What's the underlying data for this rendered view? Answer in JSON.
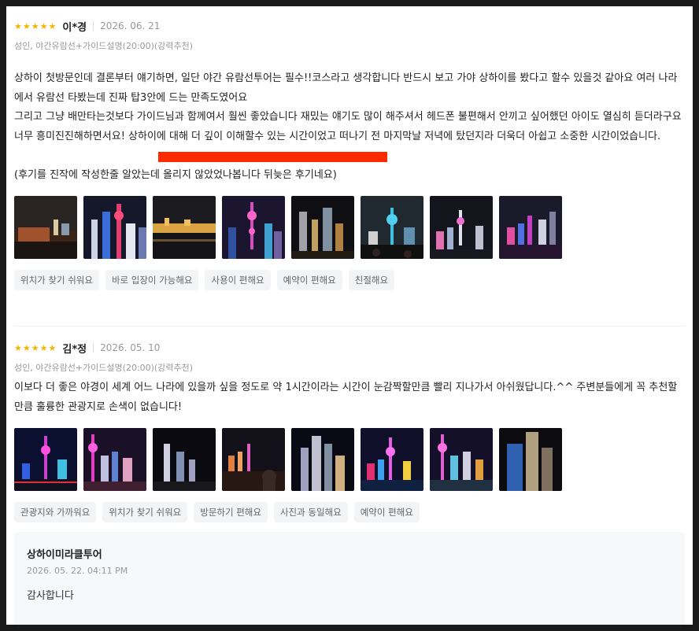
{
  "reviews": [
    {
      "rating_stars": "★★★★★",
      "author": "이*경",
      "date": "2026. 06. 21",
      "option": "성인, 야간유람선+가이드설명(20:00)(강력추천)",
      "body": "상하이 첫방문인데 결론부터 얘기하면, 일단 야간 유람선투어는 필수!!코스라고 생각합니다 반드시 보고 가야 상하이를 봤다고 할수 있을것 같아요 여러 나라에서 유람선 타봤는데 진짜 탑3안에 드는 만족도였어요\n그리고 그냥 배만타는것보다 가이드님과 함께여서 훨씬 좋았습니다 재밌는 얘기도 많이 해주셔서 헤드폰 불편해서 안끼고 싶어했던 아이도 열심히 듣더라구요 너무 흥미진진해하면서요! 상하이에 대해 더 깊이 이해할수 있는 시간이었고 떠나기 전 마지막날 저녁에 탔던지라 더욱더 아쉽고 소중한 시간이었습니다.\n\n(후기를 진작에 작성한줄 알았는데 올리지 않았었나봅니다 뒤늦은 후기네요)",
      "tags": [
        "위치가 찾기 쉬워요",
        "바로 입장이 가능해요",
        "사용이 편해요",
        "예약이 편해요",
        "친절해요"
      ]
    },
    {
      "rating_stars": "★★★★★",
      "author": "김*정",
      "date": "2026. 05. 10",
      "option": "성인, 야간유람선+가이드설명(20:00)(강력추천)",
      "body": "이보다 더 좋은 야경이 세계 어느 나라에 있을까 싶을 정도로 약 1시간이라는 시간이 눈감짝할만큼 빨리 지나가서 아쉬웠답니다.^^ 주변분들에게 꼭 추천할만큼 훌륭한 관광지로 손색이 없습니다!",
      "tags": [
        "관광지와 가까워요",
        "위치가 찾기 쉬워요",
        "방문하기 편해요",
        "사진과 동일해요",
        "예약이 편해요"
      ]
    }
  ],
  "reply": {
    "name": "상하이미라클투어",
    "date": "2026. 05. 22. 04:11 PM",
    "text": "감사합니다"
  },
  "colors": {
    "star": "#f5b400",
    "highlight": "#ff2a00",
    "tag_bg": "#f3f4f6",
    "reply_bg": "#f7f8fa"
  },
  "icons": [
    "star-icon"
  ]
}
